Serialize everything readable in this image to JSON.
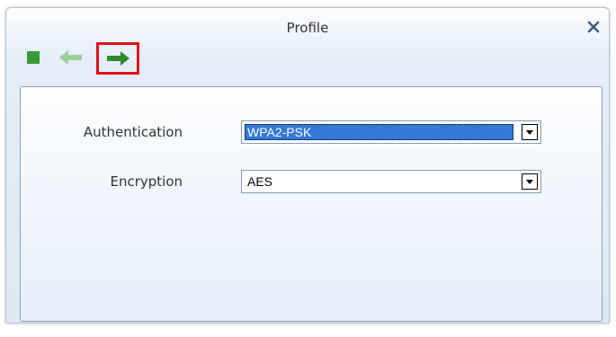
{
  "window": {
    "title": "Profile",
    "close_icon": "close-icon"
  },
  "toolbar": {
    "icons": [
      "stop-icon",
      "back-arrow-icon",
      "next-arrow-icon"
    ],
    "colors": {
      "stop": "#3a9a3a",
      "back_arrow": "#9ccf9c",
      "next_arrow": "#2e8b2e",
      "highlight_border": "#e0101a"
    }
  },
  "form": {
    "authentication": {
      "label": "Authentication",
      "value": "WPA2-PSK",
      "selected_highlight": "#3478d8"
    },
    "encryption": {
      "label": "Encryption",
      "value": "AES"
    }
  }
}
